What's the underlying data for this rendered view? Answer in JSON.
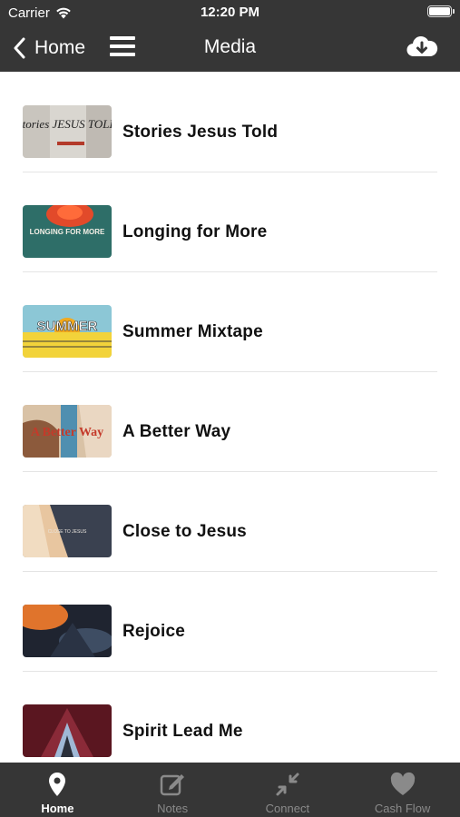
{
  "status_bar": {
    "carrier": "Carrier",
    "time": "12:20 PM"
  },
  "nav": {
    "back_label": "Home",
    "title": "Media"
  },
  "media_items": [
    {
      "title": "Stories Jesus Told",
      "thumb_text": "Stories JESUS TOLD"
    },
    {
      "title": "Longing for More",
      "thumb_text": "LONGING FOR MORE"
    },
    {
      "title": "Summer Mixtape",
      "thumb_text": "SUMMER"
    },
    {
      "title": "A Better Way",
      "thumb_text": "A Better Way"
    },
    {
      "title": "Close to Jesus",
      "thumb_text": "CLOSE TO JESUS"
    },
    {
      "title": "Rejoice",
      "thumb_text": ""
    },
    {
      "title": "Spirit Lead Me",
      "thumb_text": ""
    }
  ],
  "tabs": [
    {
      "label": "Home",
      "icon": "map-pin-icon",
      "active": true
    },
    {
      "label": "Notes",
      "icon": "edit-icon",
      "active": false
    },
    {
      "label": "Connect",
      "icon": "collapse-arrows-icon",
      "active": false
    },
    {
      "label": "Cash Flow",
      "icon": "heart-icon",
      "active": false
    }
  ],
  "colors": {
    "bar": "#363636",
    "active_tab": "#ffffff",
    "inactive_tab": "#8a8a8a"
  }
}
